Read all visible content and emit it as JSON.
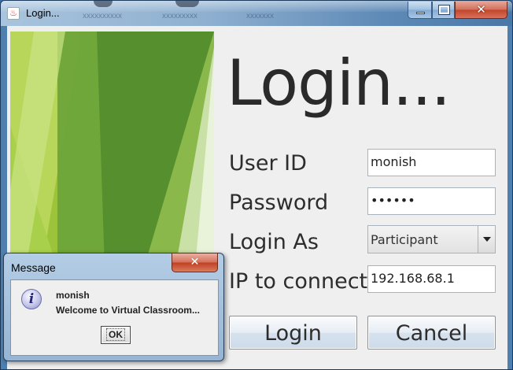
{
  "window": {
    "title": "Login...",
    "background_taskbar_labels": [
      "xxxxxxxxxx",
      "xxxxxxxxx",
      "xxxxxxx"
    ],
    "controls": {
      "minimize": "minimize",
      "maximize": "maximize",
      "close": "✕"
    }
  },
  "form": {
    "heading": "Login...",
    "user_id_label": "User ID",
    "user_id_value": "monish",
    "password_label": "Password",
    "password_value": "••••••",
    "login_as_label": "Login As",
    "login_as_value": "Participant",
    "ip_label": "IP to connect",
    "ip_value": "192.168.68.1",
    "login_button": "Login",
    "cancel_button": "Cancel"
  },
  "dialog": {
    "title": "Message",
    "close": "✕",
    "icon": "info-icon",
    "icon_glyph": "i",
    "user": "monish",
    "message": "Welcome to Virtual Classroom...",
    "ok_button": "OK"
  },
  "colors": {
    "graphic_green_dark": "#5f9a34",
    "graphic_green_light": "#9ccc3c",
    "close_red": "#c2452a",
    "titlebar_blue": "#8fb0d0"
  }
}
